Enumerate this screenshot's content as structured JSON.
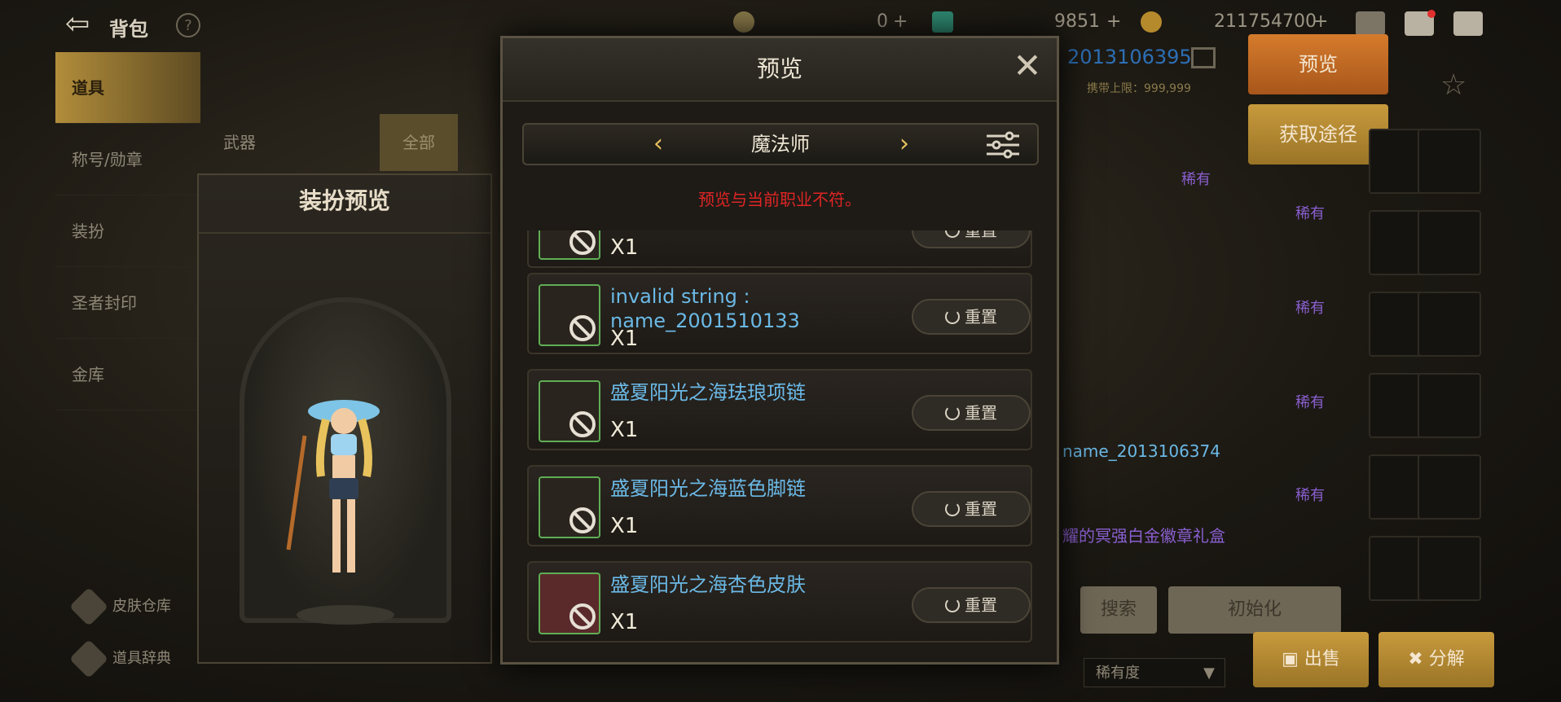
{
  "topbar": {
    "title": "背包",
    "help": "?",
    "currency1": "0",
    "currency2": "9851",
    "currency3": "211754700"
  },
  "nav": {
    "items": [
      {
        "label": "道具"
      },
      {
        "label": "称号/勋章"
      },
      {
        "label": "装扮"
      },
      {
        "label": "圣者封印"
      },
      {
        "label": "金库"
      }
    ],
    "footer": [
      {
        "label": "皮肤仓库"
      },
      {
        "label": "道具辞典"
      }
    ]
  },
  "bgtabs": {
    "weapon": "武器",
    "all": "全部"
  },
  "outfit": {
    "title": "装扮预览"
  },
  "right": {
    "id": "2013106395",
    "limit": "携带上限：999,999",
    "preview_btn": "预览",
    "obtain_btn": "获取途径",
    "rare": "稀有",
    "name_line": "name_2013106374",
    "gift_line": "耀的冥强白金徽章礼盒",
    "search_btn": "搜索",
    "init_btn": "初始化",
    "sort_label": "稀有度",
    "sell_btn": "出售",
    "disassemble_btn": "分解"
  },
  "modal": {
    "title": "预览",
    "class_name": "魔法师",
    "warning": "预览与当前职业不符。",
    "reset_label": "重置",
    "items": [
      {
        "name": "",
        "qty": "X1"
      },
      {
        "name": "invalid string : name_2001510133",
        "qty": "X1"
      },
      {
        "name": "盛夏阳光之海珐琅项链",
        "qty": "X1"
      },
      {
        "name": "盛夏阳光之海蓝色脚链",
        "qty": "X1"
      },
      {
        "name": "盛夏阳光之海杏色皮肤",
        "qty": "X1"
      }
    ]
  },
  "colors": {
    "accent_gold": "#b18d3b",
    "name_blue": "#6bb9e6",
    "warning_red": "#e02525",
    "rare_purple": "#8a5fd0",
    "frame_green": "#5fae55"
  }
}
